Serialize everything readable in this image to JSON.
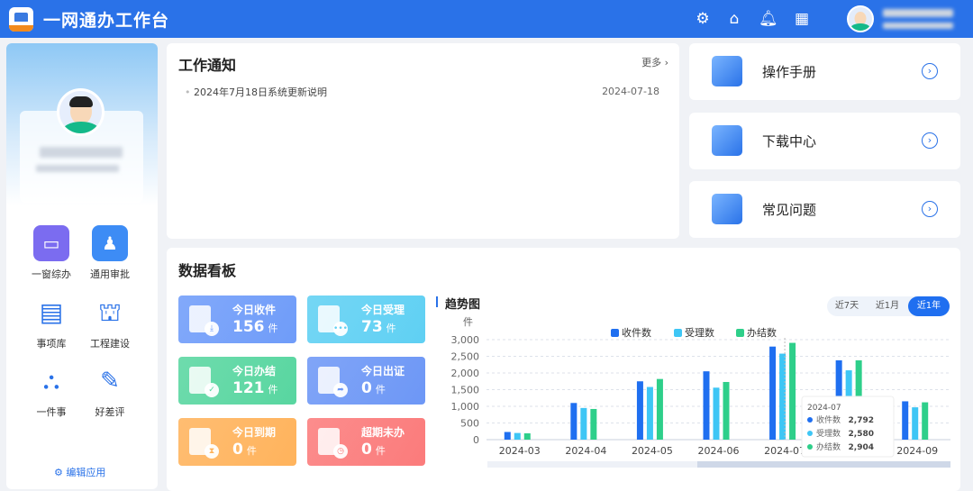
{
  "header": {
    "title": "一网通办工作台",
    "icons": [
      "gear-icon",
      "home-icon",
      "bell-icon",
      "grid-icon"
    ]
  },
  "sidebar": {
    "apps": [
      {
        "label": "一窗综办",
        "icon": "monitor-icon",
        "color": "#7b6cf0"
      },
      {
        "label": "通用审批",
        "icon": "stamp-icon",
        "color": "#3d8cf5"
      },
      {
        "label": "事项库",
        "icon": "list-doc-icon",
        "color": "#2a72e8"
      },
      {
        "label": "工程建设",
        "icon": "crane-icon",
        "color": "#2a72e8"
      },
      {
        "label": "一件事",
        "icon": "network-icon",
        "color": "#2a72e8"
      },
      {
        "label": "好差评",
        "icon": "edit-doc-icon",
        "color": "#2a72e8"
      }
    ],
    "edit_apps": "编辑应用"
  },
  "notice": {
    "title": "工作通知",
    "more": "更多",
    "items": [
      {
        "text": "2024年7月18日系统更新说明",
        "date": "2024-07-18"
      }
    ]
  },
  "quick_links": [
    {
      "label": "操作手册",
      "icon": "manual-icon"
    },
    {
      "label": "下载中心",
      "icon": "download-cloud-icon"
    },
    {
      "label": "常见问题",
      "icon": "faq-chat-icon"
    }
  ],
  "board": {
    "title": "数据看板",
    "unit": "件",
    "stats": [
      {
        "label": "今日收件",
        "value": "156",
        "color": "#6f9cf9"
      },
      {
        "label": "今日受理",
        "value": "73",
        "color": "#5fd0f3"
      },
      {
        "label": "今日办结",
        "value": "121",
        "color": "#58d6a0"
      },
      {
        "label": "今日出证",
        "value": "0",
        "color": "#6d97f6"
      },
      {
        "label": "今日到期",
        "value": "0",
        "color": "#ffb35c"
      },
      {
        "label": "超期未办",
        "value": "0",
        "color": "#fb7b7b"
      }
    ],
    "trend_title": "趋势图",
    "ranges": [
      "近7天",
      "近1月",
      "近1年"
    ],
    "active_range": "近1年"
  },
  "chart_data": {
    "type": "bar",
    "ylabel": "件",
    "ylim": [
      0,
      3000
    ],
    "yticks": [
      "0",
      "500",
      "1,000",
      "1,500",
      "2,000",
      "2,500",
      "3,000"
    ],
    "categories": [
      "2024-03",
      "2024-04",
      "2024-05",
      "2024-06",
      "2024-07",
      "2024-08",
      "2024-09"
    ],
    "legend_position": "top",
    "series": [
      {
        "name": "收件数",
        "color": "#1f6ff0",
        "values": [
          230,
          1100,
          1750,
          2050,
          2792,
          2380,
          1150
        ]
      },
      {
        "name": "受理数",
        "color": "#3ec6f5",
        "values": [
          200,
          950,
          1580,
          1560,
          2580,
          2080,
          970
        ]
      },
      {
        "name": "办结数",
        "color": "#2ecf8a",
        "values": [
          190,
          920,
          1820,
          1730,
          2904,
          2380,
          1120
        ]
      }
    ],
    "tooltip": {
      "title": "2024-07",
      "rows": [
        {
          "name": "收件数",
          "value": "2,792"
        },
        {
          "name": "受理数",
          "value": "2,580"
        },
        {
          "name": "办结数",
          "value": "2,904"
        }
      ]
    }
  }
}
